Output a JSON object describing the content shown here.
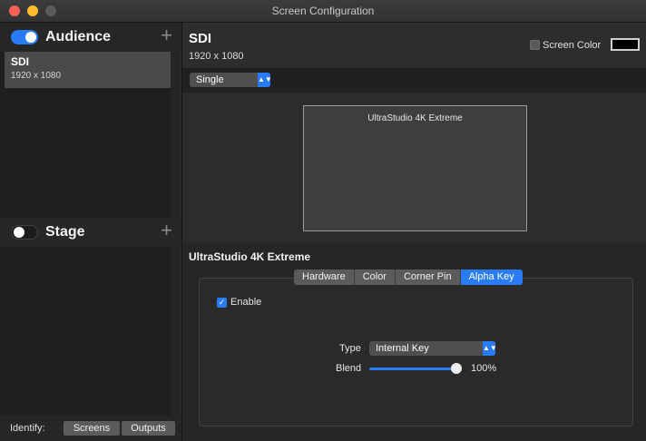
{
  "window": {
    "title": "Screen Configuration"
  },
  "sidebar": {
    "groups": [
      {
        "label": "Audience",
        "enabled": true,
        "items": [
          {
            "name": "SDI",
            "resolution": "1920 x 1080"
          }
        ]
      },
      {
        "label": "Stage",
        "enabled": false,
        "items": []
      }
    ],
    "identify": {
      "label": "Identify:",
      "buttons": [
        "Screens",
        "Outputs"
      ]
    }
  },
  "main": {
    "title": "SDI",
    "resolution": "1920 x 1080",
    "screen_color": {
      "label": "Screen Color",
      "checked": false,
      "color": "#000000"
    },
    "mode_select": {
      "value": "Single"
    },
    "preview": {
      "monitor_label": "UltraStudio 4K Extreme"
    },
    "device_title": "UltraStudio 4K Extreme",
    "tabs": [
      "Hardware",
      "Color",
      "Corner Pin",
      "Alpha Key"
    ],
    "active_tab": "Alpha Key",
    "alpha_key": {
      "enable_label": "Enable",
      "enabled": true,
      "type_label": "Type",
      "type_value": "Internal Key",
      "blend_label": "Blend",
      "blend_value": "100%",
      "blend_fraction": 1.0
    }
  },
  "colors": {
    "accent": "#2a7cf6",
    "close": "#fe5f57",
    "minimize": "#febc2e"
  }
}
